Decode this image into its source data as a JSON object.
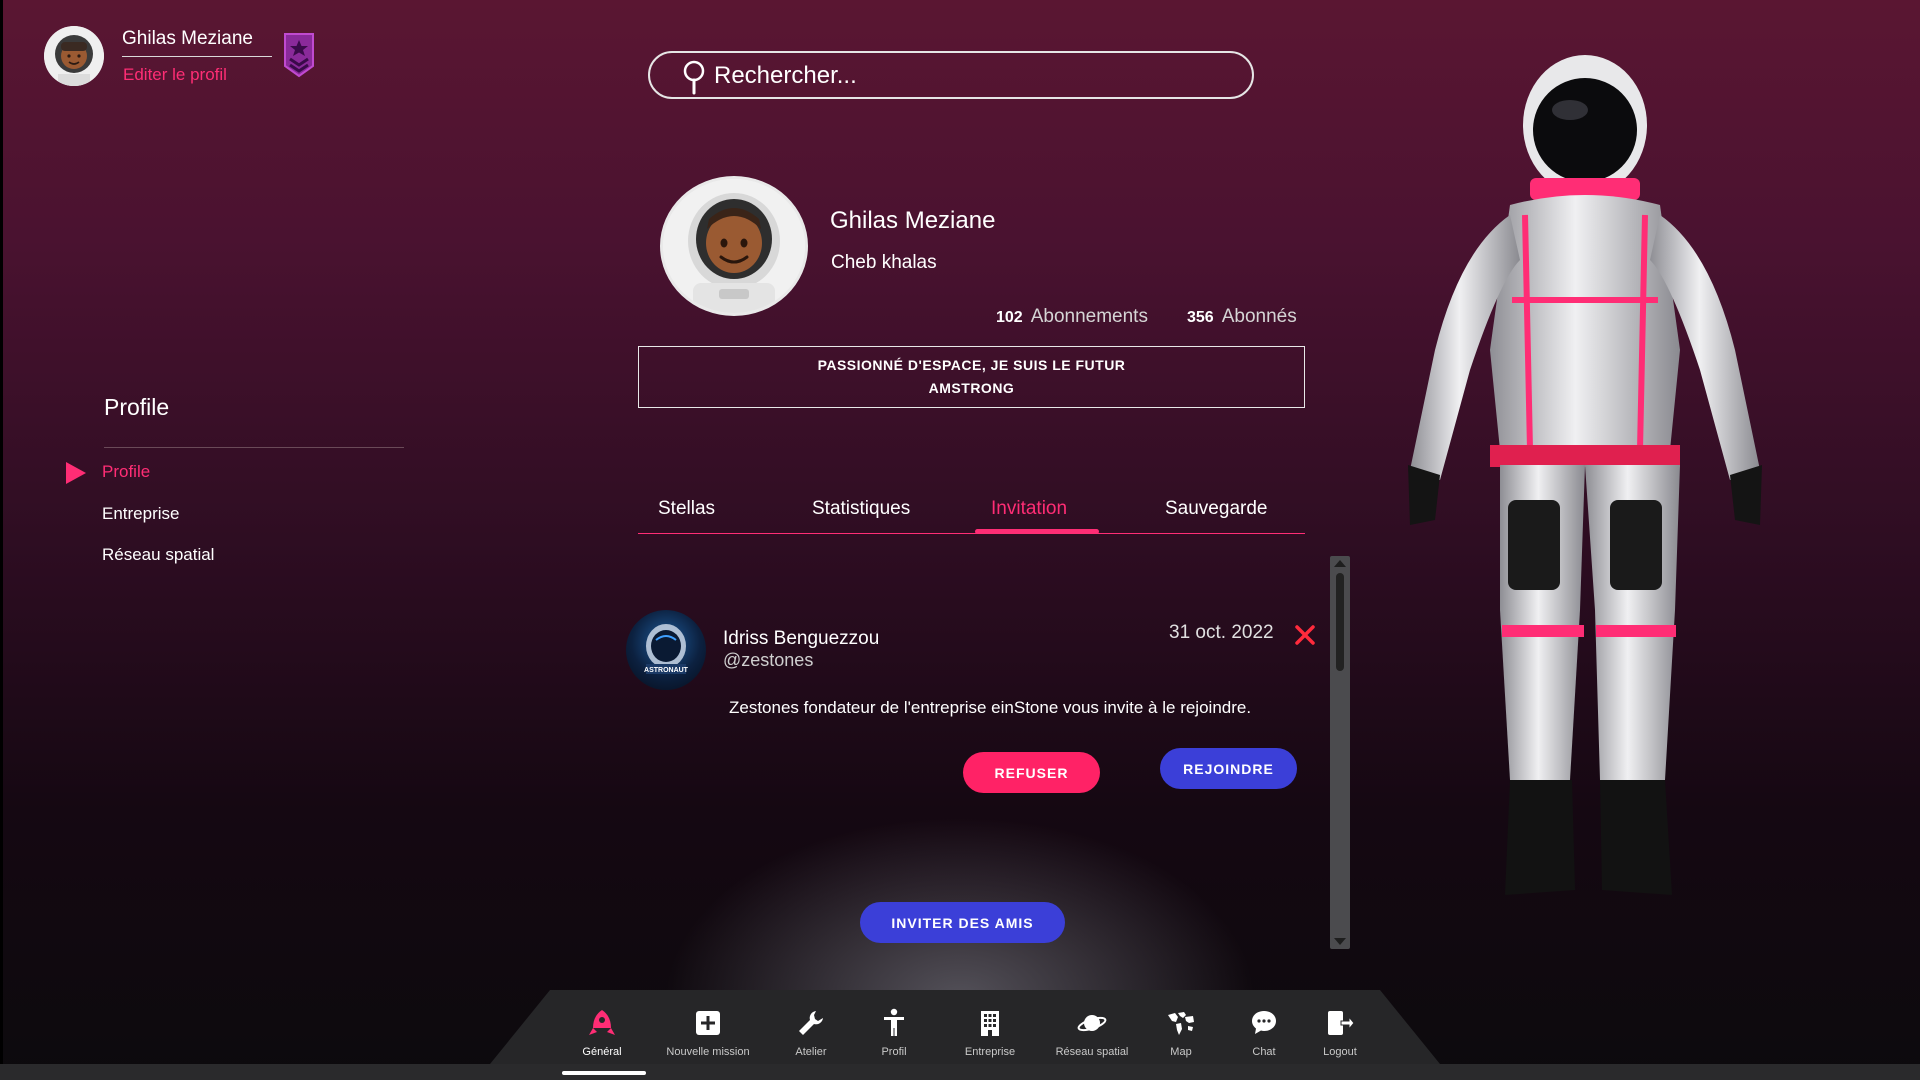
{
  "user": {
    "name": "Ghilas Meziane",
    "edit_label": "Editer le profil"
  },
  "search": {
    "placeholder": "Rechercher..."
  },
  "sidebar": {
    "title": "Profile",
    "items": [
      {
        "label": "Profile",
        "active": true
      },
      {
        "label": "Entreprise",
        "active": false
      },
      {
        "label": "Réseau spatial",
        "active": false
      }
    ]
  },
  "profile": {
    "name": "Ghilas Meziane",
    "handle": "Cheb khalas",
    "following_count": "102",
    "following_label": "Abonnements",
    "followers_count": "356",
    "followers_label": "Abonnés",
    "bio": "PASSIONNÉ D'ESPACE, JE SUIS LE FUTUR AMSTRONG"
  },
  "tabs": [
    {
      "label": "Stellas",
      "active": false
    },
    {
      "label": "Statistiques",
      "active": false
    },
    {
      "label": "Invitation",
      "active": true
    },
    {
      "label": "Sauvegarde",
      "active": false
    }
  ],
  "invitation": {
    "sender_name": "Idriss Benguezzou",
    "sender_handle": "@zestones",
    "date": "31 oct. 2022",
    "message": "Zestones fondateur de l'entreprise einStone vous invite à le rejoindre.",
    "refuse_label": "REFUSER",
    "join_label": "REJOINDRE",
    "avatar_text": "ASTRONAUT"
  },
  "invite_friends_label": "INVITER DES AMIS",
  "bottom_nav": [
    {
      "label": "Général",
      "icon": "rocket-icon",
      "active": true
    },
    {
      "label": "Nouvelle mission",
      "icon": "plus-square-icon",
      "active": false
    },
    {
      "label": "Atelier",
      "icon": "wrench-icon",
      "active": false
    },
    {
      "label": "Profil",
      "icon": "person-icon",
      "active": false
    },
    {
      "label": "Entreprise",
      "icon": "building-icon",
      "active": false
    },
    {
      "label": "Réseau spatial",
      "icon": "planet-icon",
      "active": false
    },
    {
      "label": "Map",
      "icon": "world-map-icon",
      "active": false
    },
    {
      "label": "Chat",
      "icon": "chat-bubble-icon",
      "active": false
    },
    {
      "label": "Logout",
      "icon": "logout-icon",
      "active": false
    }
  ],
  "colors": {
    "accent_pink": "#ff2d75",
    "accent_blue": "#3b3fd8",
    "background_top": "#5a1632",
    "background_bottom": "#0c0a0d"
  }
}
